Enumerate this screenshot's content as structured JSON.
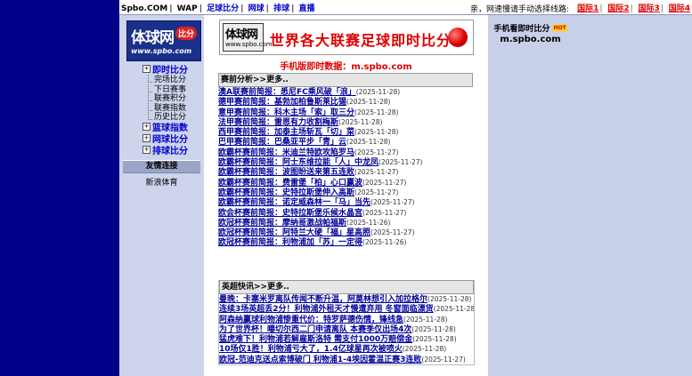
{
  "topnav": {
    "items": [
      "Spbo.COM",
      "WAP",
      "足球比分",
      "网球",
      "排球",
      "直播"
    ],
    "notice": "亲，网速慢请手动选择线路:",
    "lines": [
      "国际1",
      "国际2",
      "国际3",
      "国际4"
    ]
  },
  "logo": {
    "text": "体球网",
    "badge": "比分",
    "url": "www.spbo.com"
  },
  "menu": {
    "football": "即时比分",
    "football_subs": [
      "完场比分",
      "下日赛事",
      "联赛积分",
      "联赛指数",
      "历史比分"
    ],
    "basketball": "篮球指数",
    "tennis": "网球比分",
    "volleyball": "排球比分"
  },
  "friends": {
    "title": "友情连接",
    "items": [
      "新浪体育"
    ]
  },
  "banner": {
    "logo_text": "体球网",
    "logo_url": "www.spbo.com",
    "text": "世界各大联赛足球即时比分"
  },
  "mobile": {
    "label": "手机版即时数据：",
    "url": "m.spbo.com"
  },
  "analysis": {
    "title": "赛前分析",
    "more": ">>更多..",
    "rows": [
      {
        "text": "澳A联赛前简报：悉尼FC乘风破「浪」",
        "date": "(2025-11-28)"
      },
      {
        "text": "德甲赛前简报：基勃加柏鲁斯莱比锡",
        "date": "(2025-11-28)"
      },
      {
        "text": "意甲赛前简报：科木主场「索」取三分",
        "date": "(2025-11-28)"
      },
      {
        "text": "法甲赛前简报：雷恩有力收割梅斯",
        "date": "(2025-11-28)"
      },
      {
        "text": "西甲赛前简报：加泰主场斩瓦「切」菜",
        "date": "(2025-11-28)"
      },
      {
        "text": "巴甲赛前简报：巴桑亚平步「青」云",
        "date": "(2025-11-28)"
      },
      {
        "text": "欧霸杯赛前简报：米迪兰特欧攻陷罗马",
        "date": "(2025-11-27)"
      },
      {
        "text": "欧霸杯赛前简报：阿士东维拉能「人」中龙凤",
        "date": "(2025-11-27)"
      },
      {
        "text": "欧霸杯赛前简报：波图盼送来第五连败",
        "date": "(2025-11-27)"
      },
      {
        "text": "欧霸杯赛前简报：费雷堡「柏」心口赢波",
        "date": "(2025-11-27)"
      },
      {
        "text": "欧霸杯赛前简报：史特拉斯堡伸入高斯",
        "date": "(2025-11-27)"
      },
      {
        "text": "欧霸杯赛前简报：诺定威森林一「马」当先",
        "date": "(2025-11-27)"
      },
      {
        "text": "欧会杯赛前简报：史特拉斯堡乐候水晶宫",
        "date": "(2025-11-27)"
      },
      {
        "text": "欧冠杯赛前简报：摩纳哥激战帕福斯",
        "date": "(2025-11-26)"
      },
      {
        "text": "欧冠杯赛前简报：阿特兰大硬「福」星高照",
        "date": "(2025-11-27)"
      },
      {
        "text": "欧冠杯赛前简报：利物浦加「苏」一定得",
        "date": "(2025-11-26)"
      }
    ]
  },
  "news": {
    "title": "英超快讯",
    "more": ">>更多..",
    "rows": [
      {
        "text": "曼晚：卡塞米罗离队传闻不断升温，阿莫林想引入加拉格尔",
        "date": "(2025-11-28)"
      },
      {
        "text": "连续3场英超丢2分！利物浦外租天才慢遭弃用 冬窗面临漂货",
        "date": "(2025-11-28)"
      },
      {
        "text": "阿森纳赢球利物浦惨重代价：特罗萨德伤情，锋线急",
        "date": "(2025-11-28)"
      },
      {
        "text": "为了世界杯！曝切尔西二门申请离队 本赛季仅出场4次",
        "date": "(2025-11-28)"
      },
      {
        "text": "猛虎难下！利物浦若解雇斯洛特 需支付1000万赔偿金",
        "date": "(2025-11-28)"
      },
      {
        "text": "10场仅1胜！利物浦亏大了，1.4亿球星再次被喷火",
        "date": "(2025-11-28)"
      },
      {
        "text": "欧冠-范迪克送点索博破门 利物浦1-4埃因霍温正赛3连败",
        "date": "(2025-11-27)"
      }
    ]
  },
  "right": {
    "title": "手机看即时比分",
    "hot": "HOT",
    "url": "m.spbo.com"
  }
}
